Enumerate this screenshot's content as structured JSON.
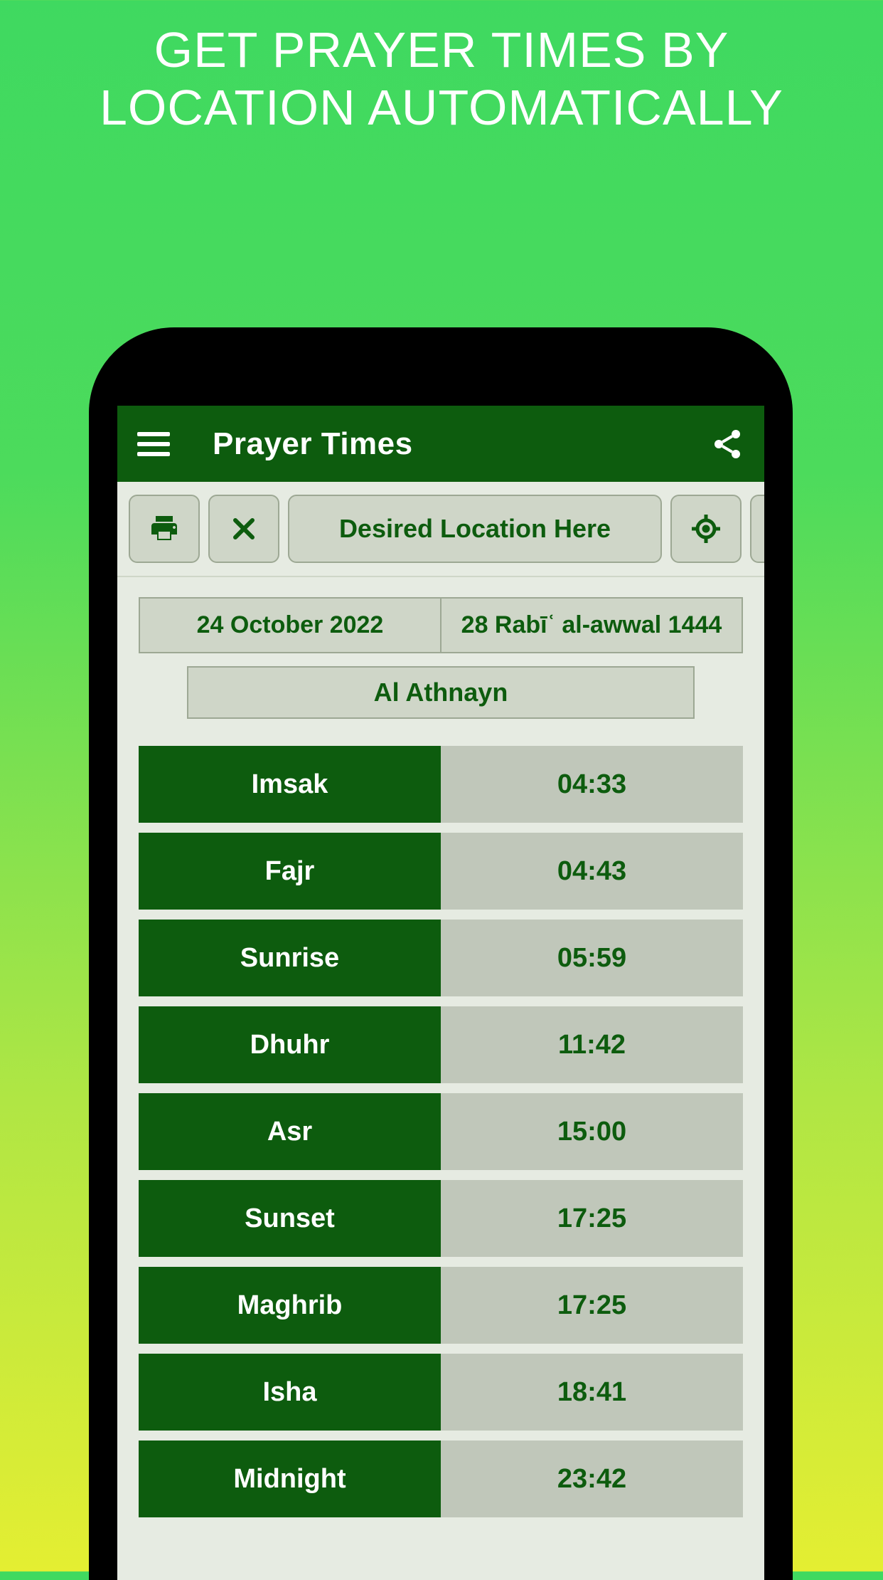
{
  "promo": {
    "headline": "GET PRAYER TIMES BY LOCATION AUTOMATICALLY"
  },
  "header": {
    "title": "Prayer Times"
  },
  "toolbar": {
    "location_placeholder": "Desired Location Here"
  },
  "dates": {
    "gregorian": "24 October 2022",
    "hijri": "28 Rabīʿ al-awwal 1444",
    "weekday": "Al Athnayn"
  },
  "prayers": [
    {
      "name": "Imsak",
      "time": "04:33"
    },
    {
      "name": "Fajr",
      "time": "04:43"
    },
    {
      "name": "Sunrise",
      "time": "05:59"
    },
    {
      "name": "Dhuhr",
      "time": "11:42"
    },
    {
      "name": "Asr",
      "time": "15:00"
    },
    {
      "name": "Sunset",
      "time": "17:25"
    },
    {
      "name": "Maghrib",
      "time": "17:25"
    },
    {
      "name": "Isha",
      "time": "18:41"
    },
    {
      "name": "Midnight",
      "time": "23:42"
    }
  ]
}
